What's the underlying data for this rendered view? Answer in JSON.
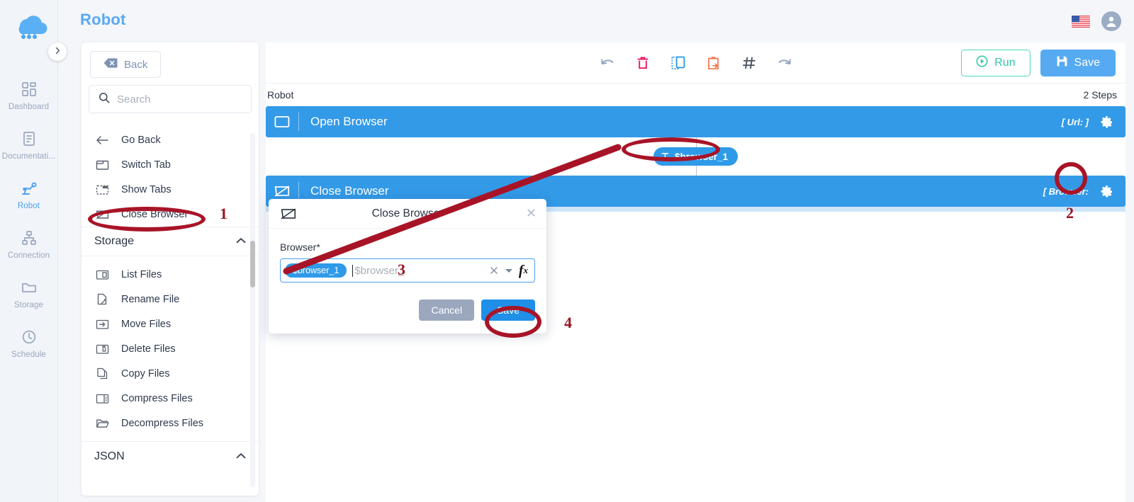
{
  "app": {
    "title": "Robot",
    "logo_icon": "cloud-network-logo",
    "collapse_icon": "chevron-right-icon"
  },
  "header": {
    "language_icon": "us-flag-icon",
    "account_icon": "user-avatar-icon"
  },
  "rail": {
    "items": [
      {
        "label": "Dashboard",
        "icon": "dashboard-grid-icon",
        "active": false
      },
      {
        "label": "Documentati...",
        "icon": "document-icon",
        "active": false
      },
      {
        "label": "Robot",
        "icon": "robot-arm-icon",
        "active": true
      },
      {
        "label": "Connection",
        "icon": "sitemap-icon",
        "active": false
      },
      {
        "label": "Storage",
        "icon": "folder-icon",
        "active": false
      },
      {
        "label": "Schedule",
        "icon": "clock-icon",
        "active": false
      }
    ]
  },
  "panel": {
    "back_label": "Back",
    "back_icon": "backspace-icon",
    "search_placeholder": "Search",
    "search_value": "",
    "search_icon": "search-icon",
    "browser_actions": [
      {
        "label": "Go Back",
        "icon": "arrow-left-icon",
        "highlighted": false
      },
      {
        "label": "Switch Tab",
        "icon": "tab-icon",
        "highlighted": false
      },
      {
        "label": "Show Tabs",
        "icon": "tabs-dashed-icon",
        "highlighted": false
      },
      {
        "label": "Close Browser",
        "icon": "close-browser-icon",
        "highlighted": true
      }
    ],
    "storage_group": {
      "label": "Storage",
      "chevron": "chevron-up-icon",
      "items": [
        {
          "label": "List Files",
          "icon": "file-list-icon"
        },
        {
          "label": "Rename File",
          "icon": "file-rename-icon"
        },
        {
          "label": "Move Files",
          "icon": "file-move-icon"
        },
        {
          "label": "Delete Files",
          "icon": "file-delete-icon"
        },
        {
          "label": "Copy Files",
          "icon": "file-copy-icon"
        },
        {
          "label": "Compress Files",
          "icon": "file-compress-icon"
        },
        {
          "label": "Decompress Files",
          "icon": "folder-open-icon"
        }
      ]
    },
    "json_group": {
      "label": "JSON",
      "chevron": "chevron-up-icon"
    }
  },
  "toolbar": {
    "icons": [
      {
        "name": "undo-icon",
        "color": "#8fa3c0"
      },
      {
        "name": "delete-icon",
        "color": "#f0125e"
      },
      {
        "name": "duplicate-icon",
        "color": "#2f9ae8"
      },
      {
        "name": "paste-icon",
        "color": "#f2744a"
      },
      {
        "name": "hash-icon",
        "color": "#4a5260"
      },
      {
        "name": "redo-icon",
        "color": "#8fa3c0"
      }
    ],
    "run_label": "Run",
    "run_icon": "play-circle-icon",
    "save_label": "Save",
    "save_icon": "floppy-disk-icon"
  },
  "canvas": {
    "flow_name": "Robot",
    "steps_count_label": "2 Steps",
    "steps": [
      {
        "name": "Open Browser",
        "icon": "browser-window-icon",
        "param_label": "[ Url:  ]",
        "gear_icon": "gear-icon"
      },
      {
        "name": "Close Browser",
        "icon": "close-browser-icon",
        "param_label": "[ Browser:",
        "gear_icon": "gear-icon"
      }
    ],
    "connector_variable": {
      "label": "$browser_1",
      "icon": "text-type-icon"
    }
  },
  "modal": {
    "title": "Close Browser",
    "title_icon": "close-browser-icon",
    "close_icon": "close-icon",
    "field_label": "Browser*",
    "selected_tag": "$browser_1",
    "input_placeholder": "$browser_",
    "clear_icon": "clear-x-icon",
    "dropdown_icon": "chevron-down-icon",
    "formula_icon": "fx-icon",
    "cancel_label": "Cancel",
    "save_label": "Save"
  },
  "annotations": {
    "marks": [
      "1",
      "2",
      "3",
      "4"
    ],
    "color": "#a81427"
  },
  "colors": {
    "accent_blue": "#339ae8",
    "title_blue": "#5aa9f5",
    "run_green": "#2ec6a8",
    "annotation_red": "#a81427",
    "rail_bg": "#f1f4f9",
    "page_bg": "#f4f6fa"
  }
}
